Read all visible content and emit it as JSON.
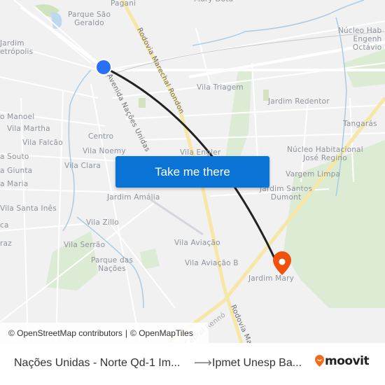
{
  "map": {
    "place_labels": [
      {
        "id": "pagani",
        "text": "Pagani"
      },
      {
        "id": "mary-dota",
        "text": "Mary Dota"
      },
      {
        "id": "parque-sao-geraldo",
        "text": "Parque São\nGeraldo"
      },
      {
        "id": "jardim-petropolis",
        "text": "Jardim\netrópolis"
      },
      {
        "id": "nucleo-eng-octavio",
        "text": "Núcleo Hab\nEngenh\nOctávio"
      },
      {
        "id": "vila-triagem",
        "text": "Vila Triagem"
      },
      {
        "id": "jardim-redentor",
        "text": "Jardim Redentor"
      },
      {
        "id": "tangaras",
        "text": "Tangarás"
      },
      {
        "id": "sao-manoel",
        "text": "o Manoel"
      },
      {
        "id": "vila-martha",
        "text": "Vila Martha"
      },
      {
        "id": "vila-falcao",
        "text": "Vila Falcão"
      },
      {
        "id": "centro",
        "text": "Centro"
      },
      {
        "id": "vila-noemy",
        "text": "Vila Noemy"
      },
      {
        "id": "vila-engler",
        "text": "Vila Engler"
      },
      {
        "id": "nucleo-jose-regino",
        "text": "Núcleo Habitacional\nJosé Regino"
      },
      {
        "id": "souto",
        "text": "a Souto"
      },
      {
        "id": "giunta",
        "text": "a Giunta"
      },
      {
        "id": "vila-clara",
        "text": "Vila Clara"
      },
      {
        "id": "vargem-limpa",
        "text": "Vargem Limpa"
      },
      {
        "id": "vila-maria",
        "text": "a Maria"
      },
      {
        "id": "jardim-santos-dumont",
        "text": "Jardim Santos\nDumont"
      },
      {
        "id": "jardim-amalia",
        "text": "Jardim Amália"
      },
      {
        "id": "vila-santa-ines",
        "text": "Vila Santa Inês"
      },
      {
        "id": "ca",
        "text": "ca"
      },
      {
        "id": "vila-zillo",
        "text": "Vila Zillo"
      },
      {
        "id": "raz",
        "text": "raz"
      },
      {
        "id": "vila-serrao",
        "text": "Vila Serrão"
      },
      {
        "id": "vila-aviacao",
        "text": "Vila Aviação"
      },
      {
        "id": "parque-das-nacoes",
        "text": "Parque das\nNações"
      },
      {
        "id": "vila-aviacao-b",
        "text": "Vila Aviação B"
      },
      {
        "id": "jardim-mary",
        "text": "Jardim Mary"
      }
    ],
    "road_labels": [
      {
        "id": "rodovia-marechal-rondon",
        "text": "Rodovia Marechal Rondon"
      },
      {
        "id": "avenida-nacoes-unidas",
        "text": "Avenida Nações Unidas"
      },
      {
        "id": "cabral-renno",
        "text": "Cabral Rennó"
      },
      {
        "id": "rodovia-marechal-bottom",
        "text": "Rodovia Marechal"
      }
    ],
    "origin_marker": {
      "color": "#2a6ff5"
    },
    "destination_marker": {
      "color": "#f0510d"
    },
    "route_color": "#222222",
    "cta_label": "Take me there",
    "attribution": {
      "osm": "© OpenStreetMap contributors",
      "separator": "|",
      "omt": "© OpenMapTiles"
    }
  },
  "footer": {
    "origin": "Nações Unidas - Norte Qd-1 Im...",
    "arrow": "⟶",
    "destination": "Ipmet Unesp Ba...",
    "brand": "moovit",
    "brand_color": "#f26b1d"
  }
}
